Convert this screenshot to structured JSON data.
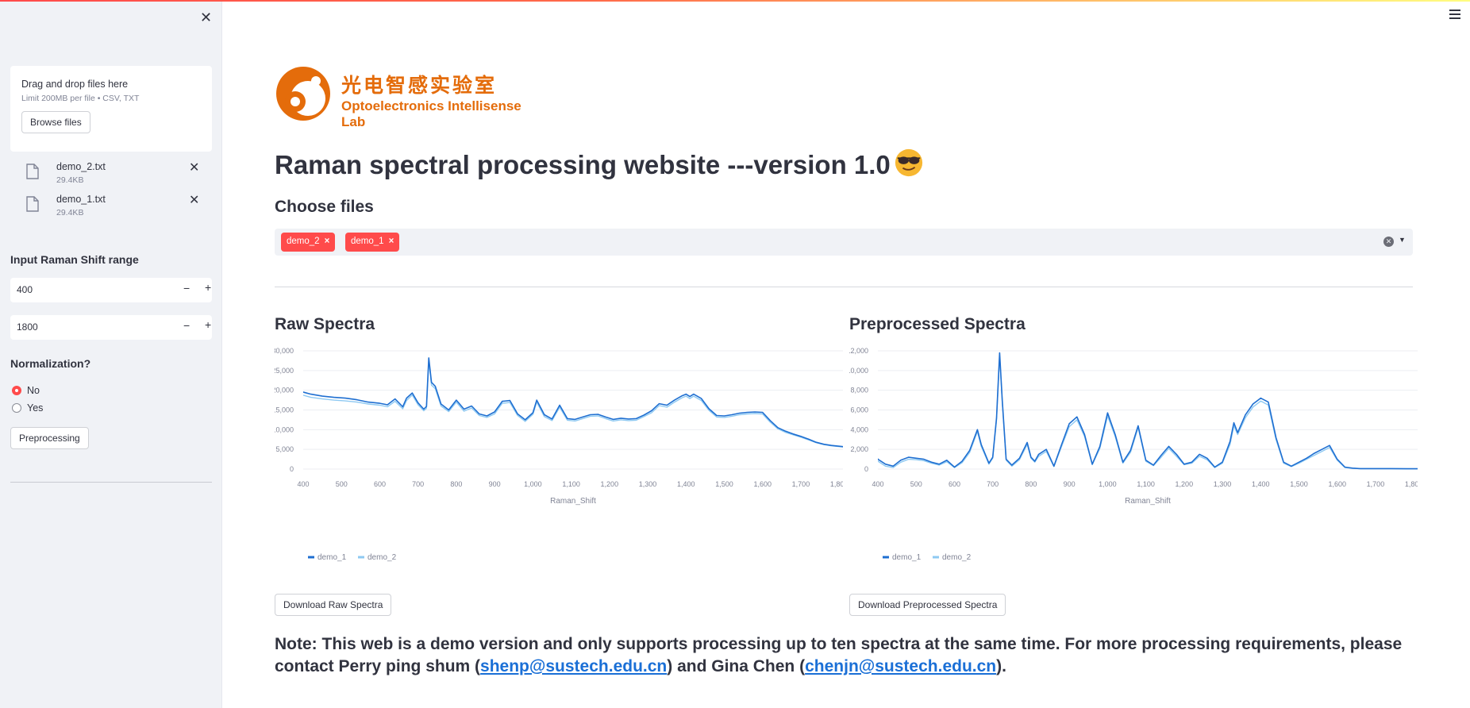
{
  "sidebar": {
    "uploader": {
      "title": "Drag and drop files here",
      "limit": "Limit 200MB per file • CSV, TXT",
      "browse_label": "Browse files"
    },
    "files": [
      {
        "name": "demo_2.txt",
        "size": "29.4KB"
      },
      {
        "name": "demo_1.txt",
        "size": "29.4KB"
      }
    ],
    "range_label": "Input Raman Shift range",
    "range_min": "400",
    "range_max": "1800",
    "normalization_label": "Normalization?",
    "norm_options": [
      "No",
      "Yes"
    ],
    "norm_selected": "No",
    "preprocess_label": "Preprocessing"
  },
  "main": {
    "logo_cn": "光电智感实验室",
    "logo_en": "Optoelectronics Intellisense Lab",
    "title": "Raman spectral processing website ---version 1.0",
    "choose_files_label": "Choose files",
    "selected_tags": [
      "demo_2",
      "demo_1"
    ],
    "download_raw_label": "Download Raw Spectra",
    "download_pre_label": "Download Preprocessed Spectra",
    "note_prefix": "Note: This web is a demo version and only supports processing up to ten spectra at the same time. For more processing requirements, please contact Perry ping shum (",
    "email1": "shenp@sustech.edu.cn",
    "note_mid": ") and Gina Chen (",
    "email2": "chenjn@sustech.edu.cn",
    "note_suffix": ")."
  },
  "colors": {
    "accent": "#ff4b4b",
    "series_demo_1": "#1f6fd1",
    "series_demo_2": "#8ec9f2",
    "logo_orange": "#e46c0b"
  },
  "chart_data": [
    {
      "type": "line",
      "title": "Raw Spectra",
      "xlabel": "Raman_Shift",
      "ylabel": "",
      "xlim": [
        400,
        1810
      ],
      "ylim": [
        0,
        30000
      ],
      "xticks": [
        "400",
        "500",
        "600",
        "700",
        "800",
        "900",
        "1,000",
        "1,100",
        "1,200",
        "1,300",
        "1,400",
        "1,500",
        "1,600",
        "1,700",
        "1,800"
      ],
      "yticks": [
        "0",
        "5,000",
        "10,000",
        "15,000",
        "20,000",
        "25,000",
        "30,000"
      ],
      "legend": "bottom-left",
      "series": [
        {
          "name": "demo_1",
          "x": [
            390,
            420,
            450,
            480,
            510,
            540,
            570,
            600,
            620,
            640,
            660,
            670,
            685,
            700,
            715,
            722,
            728,
            735,
            745,
            760,
            780,
            800,
            820,
            840,
            860,
            880,
            900,
            920,
            940,
            960,
            980,
            1000,
            1010,
            1030,
            1050,
            1070,
            1090,
            1110,
            1130,
            1150,
            1170,
            1190,
            1210,
            1230,
            1250,
            1270,
            1290,
            1310,
            1330,
            1350,
            1370,
            1390,
            1400,
            1410,
            1420,
            1440,
            1460,
            1480,
            1500,
            1520,
            1540,
            1560,
            1580,
            1600,
            1620,
            1640,
            1660,
            1680,
            1700,
            1720,
            1740,
            1760,
            1780,
            1800,
            1820
          ],
          "y": [
            19800,
            19000,
            18500,
            18200,
            18000,
            17600,
            17000,
            16700,
            16300,
            17800,
            15800,
            18000,
            19300,
            16800,
            15200,
            15900,
            28200,
            22000,
            21000,
            16500,
            15000,
            17500,
            15200,
            16000,
            14000,
            13500,
            14500,
            17200,
            17400,
            14000,
            12500,
            14300,
            17500,
            13800,
            12700,
            16200,
            12800,
            12600,
            13200,
            13800,
            13900,
            13200,
            12600,
            12900,
            12700,
            12800,
            13700,
            14800,
            16600,
            16200,
            17500,
            18600,
            19000,
            18400,
            19000,
            17900,
            15300,
            13600,
            13500,
            13800,
            14200,
            14400,
            14500,
            14400,
            12300,
            10500,
            9600,
            8900,
            8300,
            7600,
            6800,
            6300,
            6000,
            5800,
            5600
          ]
        },
        {
          "name": "demo_2",
          "x": [
            390,
            420,
            450,
            480,
            510,
            540,
            570,
            600,
            620,
            640,
            660,
            670,
            685,
            700,
            715,
            722,
            728,
            735,
            745,
            760,
            780,
            800,
            820,
            840,
            860,
            880,
            900,
            920,
            940,
            960,
            980,
            1000,
            1010,
            1030,
            1050,
            1070,
            1090,
            1110,
            1130,
            1150,
            1170,
            1190,
            1210,
            1230,
            1250,
            1270,
            1290,
            1310,
            1330,
            1350,
            1370,
            1390,
            1400,
            1410,
            1420,
            1440,
            1460,
            1480,
            1500,
            1520,
            1540,
            1560,
            1580,
            1600,
            1620,
            1640,
            1660,
            1680,
            1700,
            1720,
            1740,
            1760,
            1780,
            1800,
            1820
          ],
          "y": [
            19000,
            18200,
            17800,
            17500,
            17300,
            17000,
            16500,
            16200,
            15800,
            17200,
            15300,
            17400,
            18800,
            16300,
            14800,
            15400,
            27400,
            21300,
            20400,
            16000,
            14600,
            17000,
            14700,
            15500,
            13600,
            13100,
            14000,
            16700,
            16900,
            13600,
            12100,
            13900,
            17000,
            13300,
            12300,
            15700,
            12400,
            12200,
            12800,
            13400,
            13500,
            12800,
            12200,
            12500,
            12300,
            12400,
            13300,
            14300,
            16100,
            15700,
            17000,
            18100,
            18500,
            17900,
            18500,
            17400,
            14900,
            13200,
            13100,
            13400,
            13800,
            14000,
            14100,
            14000,
            11900,
            10200,
            9300,
            8700,
            8100,
            7400,
            6700,
            6200,
            5900,
            5700,
            5500
          ]
        }
      ]
    },
    {
      "type": "line",
      "title": "Preprocessed Spectra",
      "xlabel": "Raman_Shift",
      "ylabel": "",
      "xlim": [
        400,
        1810
      ],
      "ylim": [
        0,
        12000
      ],
      "xticks": [
        "400",
        "500",
        "600",
        "700",
        "800",
        "900",
        "1,000",
        "1,100",
        "1,200",
        "1,300",
        "1,400",
        "1,500",
        "1,600",
        "1,700",
        "1,800"
      ],
      "yticks": [
        "0",
        "2,000",
        "4,000",
        "6,000",
        "8,000",
        "10,000",
        "12,000"
      ],
      "legend": "bottom-left",
      "series": [
        {
          "name": "demo_1",
          "x": [
            390,
            400,
            420,
            440,
            460,
            480,
            500,
            520,
            540,
            560,
            580,
            600,
            620,
            640,
            660,
            670,
            690,
            700,
            710,
            718,
            725,
            735,
            750,
            770,
            790,
            800,
            810,
            820,
            840,
            860,
            880,
            900,
            920,
            940,
            960,
            980,
            1000,
            1020,
            1040,
            1060,
            1080,
            1100,
            1120,
            1140,
            1160,
            1180,
            1200,
            1220,
            1240,
            1260,
            1280,
            1300,
            1320,
            1330,
            1340,
            1360,
            1380,
            1400,
            1420,
            1440,
            1460,
            1480,
            1500,
            1520,
            1540,
            1560,
            1580,
            1600,
            1620,
            1640,
            1660,
            1700,
            1740,
            1780,
            1820
          ],
          "y": [
            1600,
            1000,
            500,
            300,
            900,
            1200,
            1100,
            1000,
            700,
            500,
            900,
            200,
            800,
            1900,
            4000,
            2500,
            600,
            1200,
            5200,
            11800,
            7000,
            1000,
            400,
            1100,
            2700,
            1200,
            800,
            1500,
            2000,
            300,
            2500,
            4600,
            5300,
            3500,
            500,
            2300,
            5700,
            3500,
            700,
            1900,
            4400,
            900,
            400,
            1400,
            2300,
            1500,
            500,
            700,
            1500,
            1100,
            200,
            700,
            2800,
            4700,
            3700,
            5500,
            6600,
            7200,
            6800,
            3200,
            700,
            300,
            700,
            1100,
            1600,
            2000,
            2400,
            1000,
            200,
            100,
            50,
            50,
            50,
            30,
            30
          ]
        },
        {
          "name": "demo_2",
          "x": [
            390,
            400,
            420,
            440,
            460,
            480,
            500,
            520,
            540,
            560,
            580,
            600,
            620,
            640,
            660,
            670,
            690,
            700,
            710,
            718,
            725,
            735,
            750,
            770,
            790,
            800,
            810,
            820,
            840,
            860,
            880,
            900,
            920,
            940,
            960,
            980,
            1000,
            1020,
            1040,
            1060,
            1080,
            1100,
            1120,
            1140,
            1160,
            1180,
            1200,
            1220,
            1240,
            1260,
            1280,
            1300,
            1320,
            1330,
            1340,
            1360,
            1380,
            1400,
            1420,
            1440,
            1460,
            1480,
            1500,
            1520,
            1540,
            1560,
            1580,
            1600,
            1620,
            1640,
            1660,
            1700,
            1740,
            1780,
            1820
          ],
          "y": [
            1400,
            800,
            300,
            150,
            700,
            1000,
            950,
            850,
            600,
            400,
            750,
            150,
            650,
            1700,
            3800,
            2300,
            500,
            1100,
            5000,
            11500,
            6800,
            900,
            300,
            950,
            2500,
            1100,
            700,
            1300,
            1800,
            250,
            2300,
            4300,
            5000,
            3300,
            450,
            2100,
            5400,
            3300,
            600,
            1700,
            4200,
            800,
            350,
            1200,
            2100,
            1300,
            450,
            600,
            1300,
            950,
            150,
            600,
            2500,
            4400,
            3500,
            5200,
            6300,
            6900,
            6500,
            3000,
            600,
            250,
            600,
            1000,
            1400,
            1800,
            2200,
            900,
            150,
            80,
            50,
            50,
            50,
            30,
            30
          ]
        }
      ]
    }
  ]
}
